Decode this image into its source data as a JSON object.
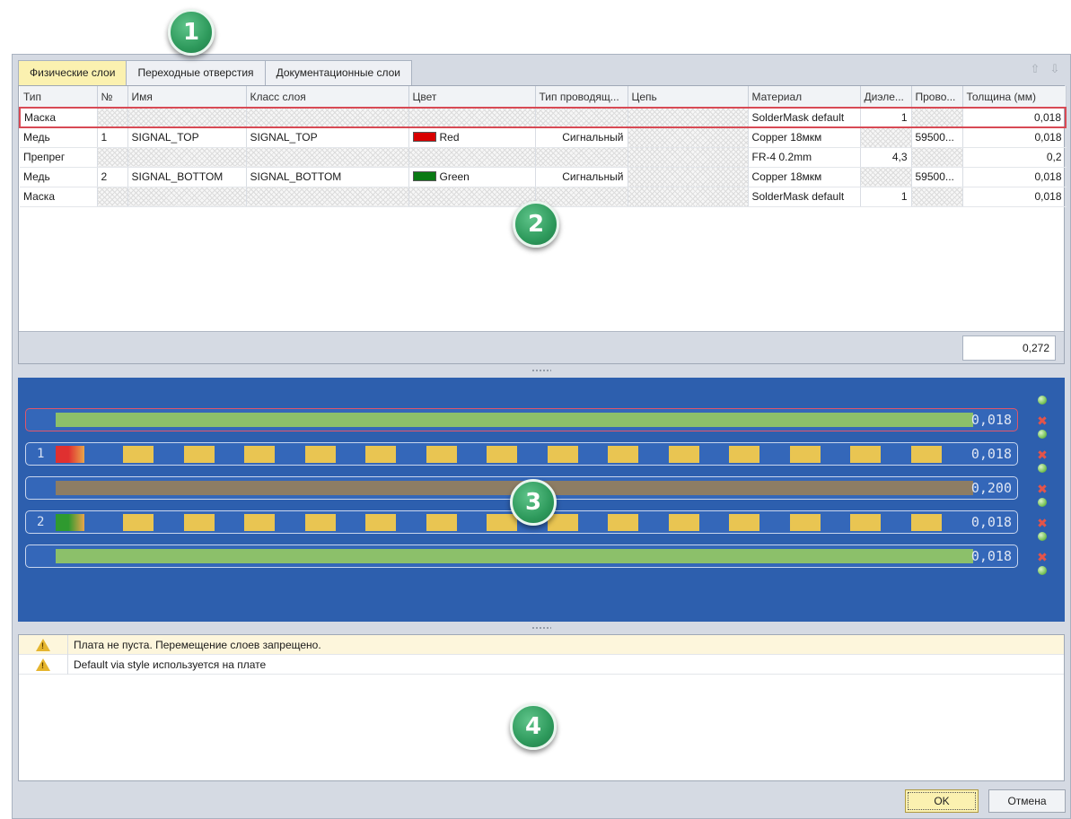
{
  "badges": [
    "1",
    "2",
    "3",
    "4"
  ],
  "tabs": [
    "Физические слои",
    "Переходные отверстия",
    "Документационные слои"
  ],
  "grid": {
    "columns": [
      "Тип",
      "№",
      "Имя",
      "Класс слоя",
      "Цвет",
      "Тип проводящ...",
      "Цепь",
      "Материал",
      "Диэле...",
      "Прово...",
      "Толщина (мм)"
    ],
    "rows": [
      {
        "type": "Маска",
        "num": "",
        "name": "",
        "class": "",
        "color": "",
        "swatch": "",
        "ctype": "",
        "net": "",
        "material": "SolderMask default",
        "diel": "1",
        "cond": "",
        "thick": "0,018"
      },
      {
        "type": "Медь",
        "num": "1",
        "name": "SIGNAL_TOP",
        "class": "SIGNAL_TOP",
        "color": "Red",
        "swatch": "#d80000",
        "ctype": "Сигнальный",
        "net": "",
        "material": "Copper 18мкм",
        "diel": "",
        "cond": "59500...",
        "thick": "0,018"
      },
      {
        "type": "Препрег",
        "num": "",
        "name": "",
        "class": "",
        "color": "",
        "swatch": "",
        "ctype": "",
        "net": "",
        "material": "FR-4 0.2mm",
        "diel": "4,3",
        "cond": "",
        "thick": "0,2"
      },
      {
        "type": "Медь",
        "num": "2",
        "name": "SIGNAL_BOTTOM",
        "class": "SIGNAL_BOTTOM",
        "color": "Green",
        "swatch": "#0a7a14",
        "ctype": "Сигнальный",
        "net": "",
        "material": "Copper 18мкм",
        "diel": "",
        "cond": "59500...",
        "thick": "0,018"
      },
      {
        "type": "Маска",
        "num": "",
        "name": "",
        "class": "",
        "color": "",
        "swatch": "",
        "ctype": "",
        "net": "",
        "material": "SolderMask default",
        "diel": "1",
        "cond": "",
        "thick": "0,018"
      }
    ],
    "total": "0,272"
  },
  "stackup": [
    {
      "kind": "mask",
      "num": "",
      "value": "0,018",
      "fill": "#8cc06a"
    },
    {
      "kind": "copper",
      "num": "1",
      "value": "0,018",
      "fill": "#e03030"
    },
    {
      "kind": "prepreg",
      "num": "",
      "value": "0,200",
      "fill": "#8d7d64"
    },
    {
      "kind": "copper",
      "num": "2",
      "value": "0,018",
      "fill": "#2f9a2f"
    },
    {
      "kind": "mask",
      "num": "",
      "value": "0,018",
      "fill": "#8cc06a"
    }
  ],
  "messages": [
    {
      "text": "Плата не пуста. Перемещение слоев запрещено.",
      "highlight": true
    },
    {
      "text": "Default via style используется на плате",
      "highlight": false
    }
  ],
  "buttons": {
    "ok": "OK",
    "cancel": "Отмена"
  },
  "colors": {
    "stack_bg": "#2d5fae",
    "pad": "#e9c552",
    "active_tab": "#fbf1b0",
    "selection": "#d84a55"
  },
  "icons": [
    "move-up-icon",
    "move-down-icon",
    "warning-icon",
    "add-layer-icon",
    "delete-layer-icon"
  ]
}
